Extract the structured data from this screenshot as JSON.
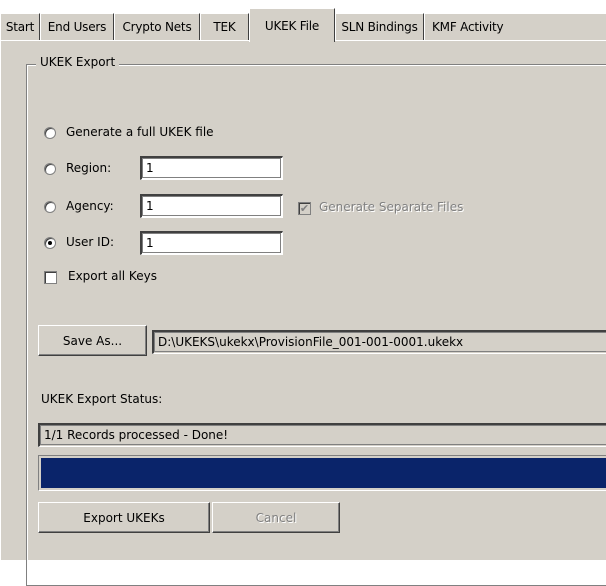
{
  "tabs": [
    {
      "label": "Start",
      "active": false
    },
    {
      "label": "End Users",
      "active": false
    },
    {
      "label": "Crypto Nets",
      "active": false
    },
    {
      "label": "TEK",
      "active": false
    },
    {
      "label": "UKEK File",
      "active": true
    },
    {
      "label": "SLN Bindings",
      "active": false
    },
    {
      "label": "KMF Activity",
      "active": false
    }
  ],
  "group": {
    "title": "UKEK Export"
  },
  "options": {
    "full_file": {
      "label": "Generate a full UKEK file",
      "selected": false
    },
    "region": {
      "label": "Region:",
      "value": "1",
      "selected": false
    },
    "agency": {
      "label": "Agency:",
      "value": "1",
      "selected": false
    },
    "user_id": {
      "label": "User ID:",
      "value": "1",
      "selected": true
    }
  },
  "separate_files": {
    "label": "Generate Separate Files",
    "checked": true,
    "enabled": false
  },
  "export_all_keys": {
    "label": "Export all Keys",
    "checked": false
  },
  "save_as": {
    "button_label": "Save As...",
    "path": "D:\\UKEKS\\ukekx\\ProvisionFile_001-001-0001.ukekx"
  },
  "status": {
    "label": "UKEK Export Status:",
    "text": "1/1 Records processed - Done!",
    "progress": 1.0
  },
  "actions": {
    "export_label": "Export UKEKs",
    "cancel_label": "Cancel"
  },
  "colors": {
    "face": "#d4d0c8",
    "progress": "#0a246a"
  }
}
